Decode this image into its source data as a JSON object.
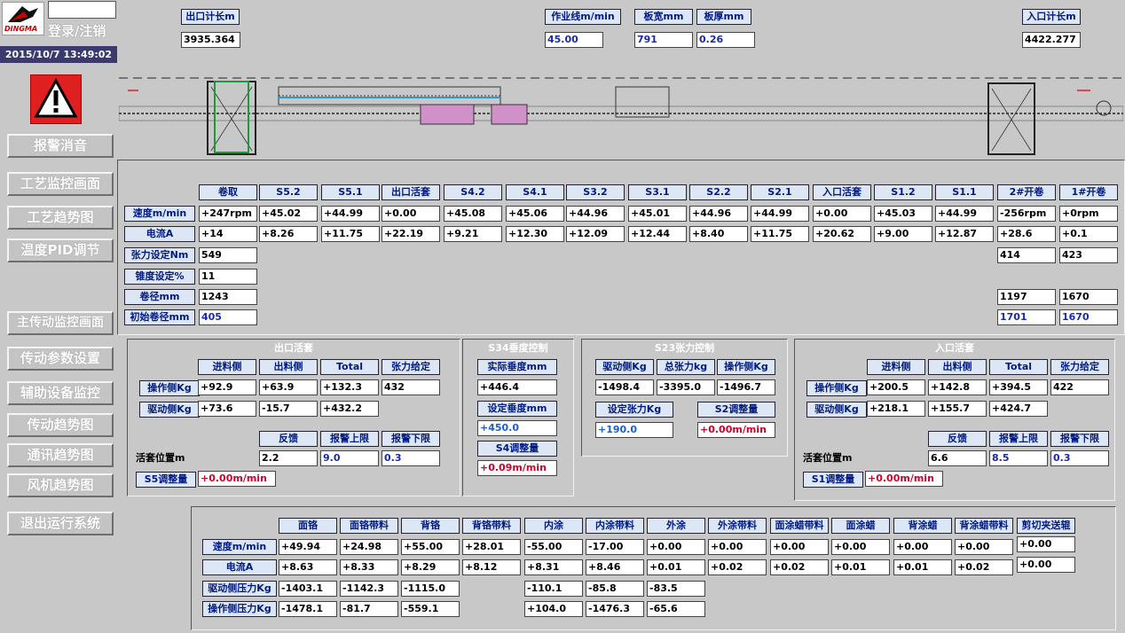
{
  "header": {
    "brand": "DINGMA",
    "login_label": "登录/注销",
    "datetime": "2015/10/7 13:49:02",
    "exit_length_label": "出口计长m",
    "exit_length_value": "3935.364",
    "line_speed_label": "作业线m/min",
    "line_speed_value": "45.00",
    "width_label": "板宽mm",
    "width_value": "791",
    "thickness_label": "板厚mm",
    "thickness_value": "0.26",
    "entry_length_label": "入口计长m",
    "entry_length_value": "4422.277"
  },
  "nav": {
    "alarm_icon": "warning-icon",
    "alarm_silence": "报警消音",
    "process_monitor": "工艺监控画面",
    "process_trend": "工艺趋势图",
    "temp_pid": "温度PID调节",
    "main_drive_monitor": "主传动监控画面",
    "drive_params": "传动参数设置",
    "aux_monitor": "辅助设备监控",
    "drive_trend": "传动趋势图",
    "comm_trend": "通讯趋势图",
    "fan_trend": "风机趋势图",
    "exit_system": "退出运行系统"
  },
  "main_table": {
    "columns": [
      "卷取",
      "S5.2",
      "S5.1",
      "出口活套",
      "S4.2",
      "S4.1",
      "S3.2",
      "S3.1",
      "S2.2",
      "S2.1",
      "入口活套",
      "S1.2",
      "S1.1",
      "2#开卷",
      "1#开卷"
    ],
    "speed_label": "速度m/min",
    "speed": [
      "+247rpm",
      "+45.02",
      "+44.99",
      "+0.00",
      "+45.08",
      "+45.06",
      "+44.96",
      "+45.01",
      "+44.96",
      "+44.99",
      "+0.00",
      "+45.03",
      "+44.99",
      "-256rpm",
      "+0rpm"
    ],
    "current_label": "电流A",
    "current": [
      "+14",
      "+8.26",
      "+11.75",
      "+22.19",
      "+9.21",
      "+12.30",
      "+12.09",
      "+12.44",
      "+8.40",
      "+11.75",
      "+20.62",
      "+9.00",
      "+12.87",
      "+28.6",
      "+0.1"
    ],
    "tension_label": "张力设定Nm",
    "tension": [
      "549",
      "414",
      "423"
    ],
    "taper_label": "锥度设定%",
    "taper": [
      "11"
    ],
    "coil_dia_label": "卷径mm",
    "coil_dia": [
      "1243",
      "1197",
      "1670"
    ],
    "init_dia_label": "初始卷径mm",
    "init_dia": [
      "405",
      "1701",
      "1670"
    ]
  },
  "exit_loop": {
    "title": "出口活套",
    "headers": [
      "进料侧",
      "出料侧",
      "Total",
      "张力给定"
    ],
    "op_label": "操作侧Kg",
    "op_row": [
      "+92.9",
      "+63.9",
      "+132.3",
      "432"
    ],
    "drive_label": "驱动侧Kg",
    "drive_row": [
      "+73.6",
      "-15.7",
      "+432.2"
    ],
    "pos_headers": [
      "反馈",
      "报警上限",
      "报警下限"
    ],
    "pos_label": "活套位置m",
    "pos_row": [
      "2.2",
      "9.0",
      "0.3"
    ],
    "adj_label": "S5调整量",
    "adj_value": "+0.00m/min"
  },
  "s34": {
    "title": "S34垂度控制",
    "actual_label": "实际垂度mm",
    "actual_value": "+446.4",
    "set_label": "设定垂度mm",
    "set_value": "+450.0",
    "adj_label": "S4调整量",
    "adj_value": "+0.09m/min"
  },
  "s23": {
    "title": "S23张力控制",
    "headers": [
      "驱动侧Kg",
      "总张力kg",
      "操作侧Kg"
    ],
    "values": [
      "-1498.4",
      "-3395.0",
      "-1496.7"
    ],
    "set_label": "设定张力Kg",
    "set_value": "+190.0",
    "adj_label": "S2调整量",
    "adj_value": "+0.00m/min"
  },
  "entry_loop": {
    "title": "入口活套",
    "headers": [
      "进料侧",
      "出料侧",
      "Total",
      "张力给定"
    ],
    "op_label": "操作侧Kg",
    "op_row": [
      "+200.5",
      "+142.8",
      "+394.5",
      "422"
    ],
    "drive_label": "驱动侧Kg",
    "drive_row": [
      "+218.1",
      "+155.7",
      "+424.7"
    ],
    "pos_headers": [
      "反馈",
      "报警上限",
      "报警下限"
    ],
    "pos_label": "活套位置m",
    "pos_row": [
      "6.6",
      "8.5",
      "0.3"
    ],
    "adj_label": "S1调整量",
    "adj_value": "+0.00m/min"
  },
  "bottom_table": {
    "columns": [
      "面铬",
      "面铬带料",
      "背铬",
      "背铬带料",
      "内涂",
      "内涂带料",
      "外涂",
      "外涂带料",
      "面涂蜡带料",
      "面涂蜡",
      "背涂蜡",
      "背涂蜡带料",
      "剪切夹送辊"
    ],
    "speed_label": "速度m/min",
    "speed": [
      "+49.94",
      "+24.98",
      "+55.00",
      "+28.01",
      "-55.00",
      "-17.00",
      "+0.00",
      "+0.00",
      "+0.00",
      "+0.00",
      "+0.00",
      "+0.00",
      "+0.00"
    ],
    "current_label": "电流A",
    "current": [
      "+8.63",
      "+8.33",
      "+8.29",
      "+8.12",
      "+8.31",
      "+8.46",
      "+0.01",
      "+0.02",
      "+0.02",
      "+0.01",
      "+0.01",
      "+0.02",
      "+0.00"
    ],
    "drive_press_label": "驱动侧压力Kg",
    "drive_press": [
      "-1403.1",
      "-1142.3",
      "-1115.0",
      "",
      "-110.1",
      "-85.8",
      "-83.5"
    ],
    "op_press_label": "操作侧压力Kg",
    "op_press": [
      "-1478.1",
      "-81.7",
      "-559.1",
      "",
      "+104.0",
      "-1476.3",
      "-65.6"
    ]
  },
  "colors": {
    "background": "#c8c8c8",
    "label_bg": "#dde6f5",
    "label_text": "#001a80",
    "alarm_red": "#e02020",
    "value_red": "#d0002a"
  }
}
